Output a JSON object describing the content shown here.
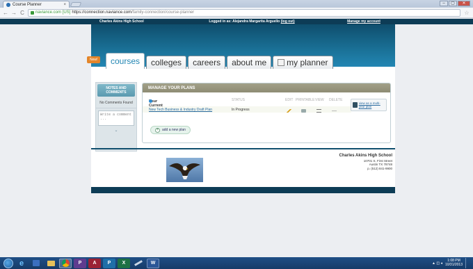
{
  "browser": {
    "tab_title": "Course Planner",
    "tab_close": "×",
    "back": "←",
    "forward": "→",
    "reload": "C",
    "url_security": "naviance.com [US]",
    "url_host": "https://connection.naviance.com",
    "url_path": "/family-connection/course-planner",
    "star": "☆",
    "window_controls": [
      "–",
      "▢",
      "✕"
    ]
  },
  "topbar": {
    "school_name": "Charles Akins High School",
    "login_text": "Logged in as: Alejandra Margarita Arguello",
    "logout": "(log out)",
    "manage_account": "Manage my account"
  },
  "nav": {
    "new_badge": "New!",
    "tabs": [
      "courses",
      "colleges",
      "careers",
      "about me",
      "my planner"
    ],
    "active_index": 0
  },
  "sidebar": {
    "notes_heading": "NOTES AND COMMENTS",
    "no_comments": "No Comments Found",
    "comment_placeholder": "Write a comment ...",
    "handle": "⌄"
  },
  "plans": {
    "heading": "MANAGE YOUR PLANS",
    "columns": {
      "plan": "Your Current Plan(s)",
      "status": "STATUS",
      "edit": "EDIT",
      "printable": "PRINTABLE",
      "view": "VIEW",
      "delete": "DELETE"
    },
    "rows": [
      {
        "name": "New Tech Business & Industry Draft Plan",
        "status": "In Progress"
      }
    ],
    "help_text": "view as a multi-year plan",
    "add_plan": "add a new plan"
  },
  "footer": {
    "school": "Charles Akins High School",
    "street": "10701 S. First Street",
    "city": "Austin TX 78748",
    "phone": "p. (512) 841-9900"
  },
  "taskbar": {
    "apps": [
      "IE",
      "W",
      "P",
      "X"
    ],
    "tray_icons": "▲ ◫ ◂",
    "time": "1:08 PM",
    "date": "10/31/2013"
  },
  "colors": {
    "header_dark": "#0d3c56",
    "header_blue": "#2286b3",
    "plans_header": "#8e8c74",
    "badge_orange": "#e3852a",
    "link_blue": "#2a6ba0"
  }
}
